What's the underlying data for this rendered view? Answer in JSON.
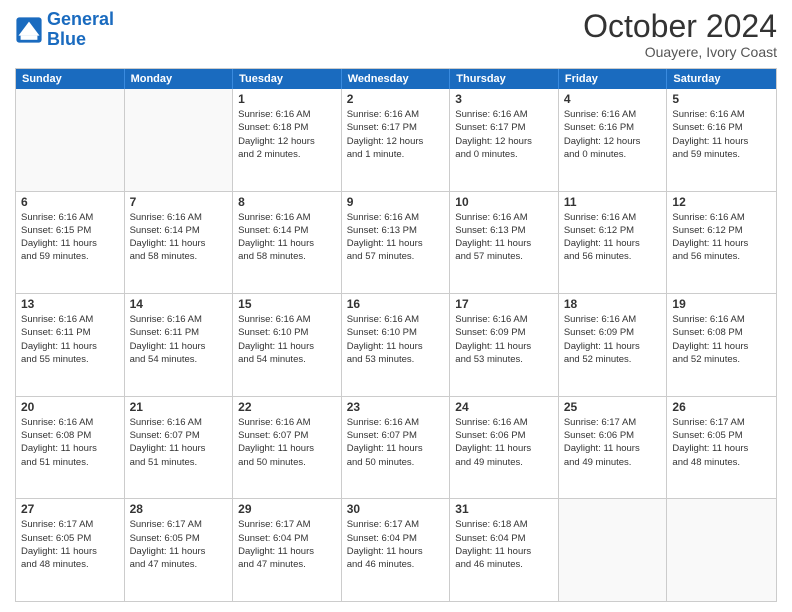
{
  "logo": {
    "text_general": "General",
    "text_blue": "Blue"
  },
  "header": {
    "month": "October 2024",
    "location": "Ouayere, Ivory Coast"
  },
  "weekdays": [
    "Sunday",
    "Monday",
    "Tuesday",
    "Wednesday",
    "Thursday",
    "Friday",
    "Saturday"
  ],
  "weeks": [
    [
      {
        "day": "",
        "lines": []
      },
      {
        "day": "",
        "lines": []
      },
      {
        "day": "1",
        "lines": [
          "Sunrise: 6:16 AM",
          "Sunset: 6:18 PM",
          "Daylight: 12 hours",
          "and 2 minutes."
        ]
      },
      {
        "day": "2",
        "lines": [
          "Sunrise: 6:16 AM",
          "Sunset: 6:17 PM",
          "Daylight: 12 hours",
          "and 1 minute."
        ]
      },
      {
        "day": "3",
        "lines": [
          "Sunrise: 6:16 AM",
          "Sunset: 6:17 PM",
          "Daylight: 12 hours",
          "and 0 minutes."
        ]
      },
      {
        "day": "4",
        "lines": [
          "Sunrise: 6:16 AM",
          "Sunset: 6:16 PM",
          "Daylight: 12 hours",
          "and 0 minutes."
        ]
      },
      {
        "day": "5",
        "lines": [
          "Sunrise: 6:16 AM",
          "Sunset: 6:16 PM",
          "Daylight: 11 hours",
          "and 59 minutes."
        ]
      }
    ],
    [
      {
        "day": "6",
        "lines": [
          "Sunrise: 6:16 AM",
          "Sunset: 6:15 PM",
          "Daylight: 11 hours",
          "and 59 minutes."
        ]
      },
      {
        "day": "7",
        "lines": [
          "Sunrise: 6:16 AM",
          "Sunset: 6:14 PM",
          "Daylight: 11 hours",
          "and 58 minutes."
        ]
      },
      {
        "day": "8",
        "lines": [
          "Sunrise: 6:16 AM",
          "Sunset: 6:14 PM",
          "Daylight: 11 hours",
          "and 58 minutes."
        ]
      },
      {
        "day": "9",
        "lines": [
          "Sunrise: 6:16 AM",
          "Sunset: 6:13 PM",
          "Daylight: 11 hours",
          "and 57 minutes."
        ]
      },
      {
        "day": "10",
        "lines": [
          "Sunrise: 6:16 AM",
          "Sunset: 6:13 PM",
          "Daylight: 11 hours",
          "and 57 minutes."
        ]
      },
      {
        "day": "11",
        "lines": [
          "Sunrise: 6:16 AM",
          "Sunset: 6:12 PM",
          "Daylight: 11 hours",
          "and 56 minutes."
        ]
      },
      {
        "day": "12",
        "lines": [
          "Sunrise: 6:16 AM",
          "Sunset: 6:12 PM",
          "Daylight: 11 hours",
          "and 56 minutes."
        ]
      }
    ],
    [
      {
        "day": "13",
        "lines": [
          "Sunrise: 6:16 AM",
          "Sunset: 6:11 PM",
          "Daylight: 11 hours",
          "and 55 minutes."
        ]
      },
      {
        "day": "14",
        "lines": [
          "Sunrise: 6:16 AM",
          "Sunset: 6:11 PM",
          "Daylight: 11 hours",
          "and 54 minutes."
        ]
      },
      {
        "day": "15",
        "lines": [
          "Sunrise: 6:16 AM",
          "Sunset: 6:10 PM",
          "Daylight: 11 hours",
          "and 54 minutes."
        ]
      },
      {
        "day": "16",
        "lines": [
          "Sunrise: 6:16 AM",
          "Sunset: 6:10 PM",
          "Daylight: 11 hours",
          "and 53 minutes."
        ]
      },
      {
        "day": "17",
        "lines": [
          "Sunrise: 6:16 AM",
          "Sunset: 6:09 PM",
          "Daylight: 11 hours",
          "and 53 minutes."
        ]
      },
      {
        "day": "18",
        "lines": [
          "Sunrise: 6:16 AM",
          "Sunset: 6:09 PM",
          "Daylight: 11 hours",
          "and 52 minutes."
        ]
      },
      {
        "day": "19",
        "lines": [
          "Sunrise: 6:16 AM",
          "Sunset: 6:08 PM",
          "Daylight: 11 hours",
          "and 52 minutes."
        ]
      }
    ],
    [
      {
        "day": "20",
        "lines": [
          "Sunrise: 6:16 AM",
          "Sunset: 6:08 PM",
          "Daylight: 11 hours",
          "and 51 minutes."
        ]
      },
      {
        "day": "21",
        "lines": [
          "Sunrise: 6:16 AM",
          "Sunset: 6:07 PM",
          "Daylight: 11 hours",
          "and 51 minutes."
        ]
      },
      {
        "day": "22",
        "lines": [
          "Sunrise: 6:16 AM",
          "Sunset: 6:07 PM",
          "Daylight: 11 hours",
          "and 50 minutes."
        ]
      },
      {
        "day": "23",
        "lines": [
          "Sunrise: 6:16 AM",
          "Sunset: 6:07 PM",
          "Daylight: 11 hours",
          "and 50 minutes."
        ]
      },
      {
        "day": "24",
        "lines": [
          "Sunrise: 6:16 AM",
          "Sunset: 6:06 PM",
          "Daylight: 11 hours",
          "and 49 minutes."
        ]
      },
      {
        "day": "25",
        "lines": [
          "Sunrise: 6:17 AM",
          "Sunset: 6:06 PM",
          "Daylight: 11 hours",
          "and 49 minutes."
        ]
      },
      {
        "day": "26",
        "lines": [
          "Sunrise: 6:17 AM",
          "Sunset: 6:05 PM",
          "Daylight: 11 hours",
          "and 48 minutes."
        ]
      }
    ],
    [
      {
        "day": "27",
        "lines": [
          "Sunrise: 6:17 AM",
          "Sunset: 6:05 PM",
          "Daylight: 11 hours",
          "and 48 minutes."
        ]
      },
      {
        "day": "28",
        "lines": [
          "Sunrise: 6:17 AM",
          "Sunset: 6:05 PM",
          "Daylight: 11 hours",
          "and 47 minutes."
        ]
      },
      {
        "day": "29",
        "lines": [
          "Sunrise: 6:17 AM",
          "Sunset: 6:04 PM",
          "Daylight: 11 hours",
          "and 47 minutes."
        ]
      },
      {
        "day": "30",
        "lines": [
          "Sunrise: 6:17 AM",
          "Sunset: 6:04 PM",
          "Daylight: 11 hours",
          "and 46 minutes."
        ]
      },
      {
        "day": "31",
        "lines": [
          "Sunrise: 6:18 AM",
          "Sunset: 6:04 PM",
          "Daylight: 11 hours",
          "and 46 minutes."
        ]
      },
      {
        "day": "",
        "lines": []
      },
      {
        "day": "",
        "lines": []
      }
    ]
  ]
}
